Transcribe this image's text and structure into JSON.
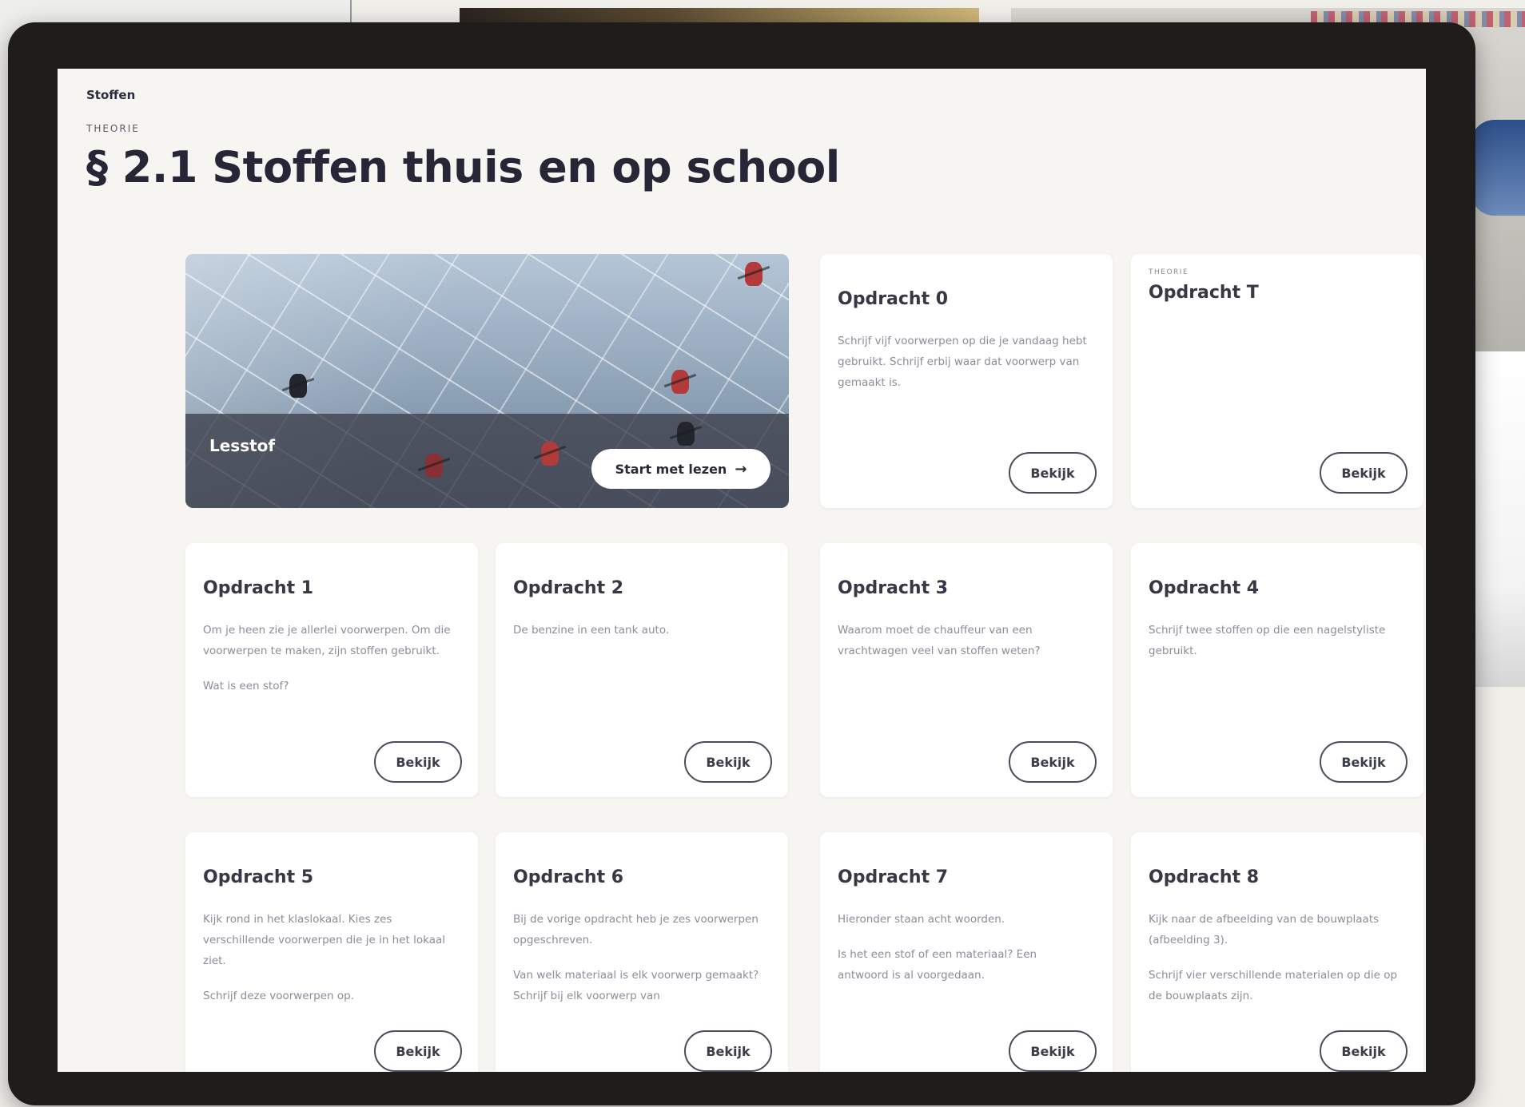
{
  "screen": {
    "breadcrumb": "Stoffen",
    "kicker": "THEORIE",
    "title": "§ 2.1 Stoffen thuis en op school"
  },
  "hero": {
    "label": "Lesstof",
    "button_label": "Start met lezen",
    "button_icon": "arrow-right-icon"
  },
  "cards": [
    {
      "kicker": "",
      "title": "Opdracht 0",
      "paragraphs": [
        "Schrijf vijf voorwerpen op die je vandaag hebt gebruikt. Schrijf erbij waar dat voorwerp van gemaakt is."
      ],
      "button": "Bekijk"
    },
    {
      "kicker": "THEORIE",
      "title": "Opdracht T",
      "paragraphs": [],
      "button": "Bekijk"
    },
    {
      "kicker": "",
      "title": "Opdracht 1",
      "paragraphs": [
        "Om je heen zie je allerlei voorwerpen. Om die voorwerpen te maken, zijn stoffen gebruikt.",
        "Wat is een stof?"
      ],
      "button": "Bekijk"
    },
    {
      "kicker": "",
      "title": "Opdracht 2",
      "paragraphs": [
        "De benzine in een tank auto."
      ],
      "button": "Bekijk"
    },
    {
      "kicker": "",
      "title": "Opdracht 3",
      "paragraphs": [
        "Waarom moet de chauffeur van een vrachtwagen veel van stoffen weten?"
      ],
      "button": "Bekijk"
    },
    {
      "kicker": "",
      "title": "Opdracht 4",
      "paragraphs": [
        "Schrijf twee stoffen op die een nagelstyliste gebruikt."
      ],
      "button": "Bekijk"
    },
    {
      "kicker": "",
      "title": "Opdracht 5",
      "paragraphs": [
        "Kijk rond in het klaslokaal. Kies zes verschillende voorwerpen die je in het lokaal ziet.",
        "Schrijf deze voorwerpen op."
      ],
      "button": "Bekijk"
    },
    {
      "kicker": "",
      "title": "Opdracht 6",
      "paragraphs": [
        "Bij de vorige opdracht heb je zes voorwerpen opgeschreven.",
        "Van welk materiaal is elk voorwerp gemaakt? Schrijf bij elk voorwerp van"
      ],
      "button": "Bekijk"
    },
    {
      "kicker": "",
      "title": "Opdracht 7",
      "paragraphs": [
        "Hieronder staan acht woorden.",
        "Is het een stof of een materiaal? Een antwoord is al voorgedaan."
      ],
      "button": "Bekijk"
    },
    {
      "kicker": "",
      "title": "Opdracht 8",
      "paragraphs": [
        "Kijk naar de afbeelding van de bouwplaats (afbeelding 3).",
        "Schrijf vier verschillende materialen op die op de bouwplaats zijn."
      ],
      "button": "Bekijk"
    }
  ]
}
